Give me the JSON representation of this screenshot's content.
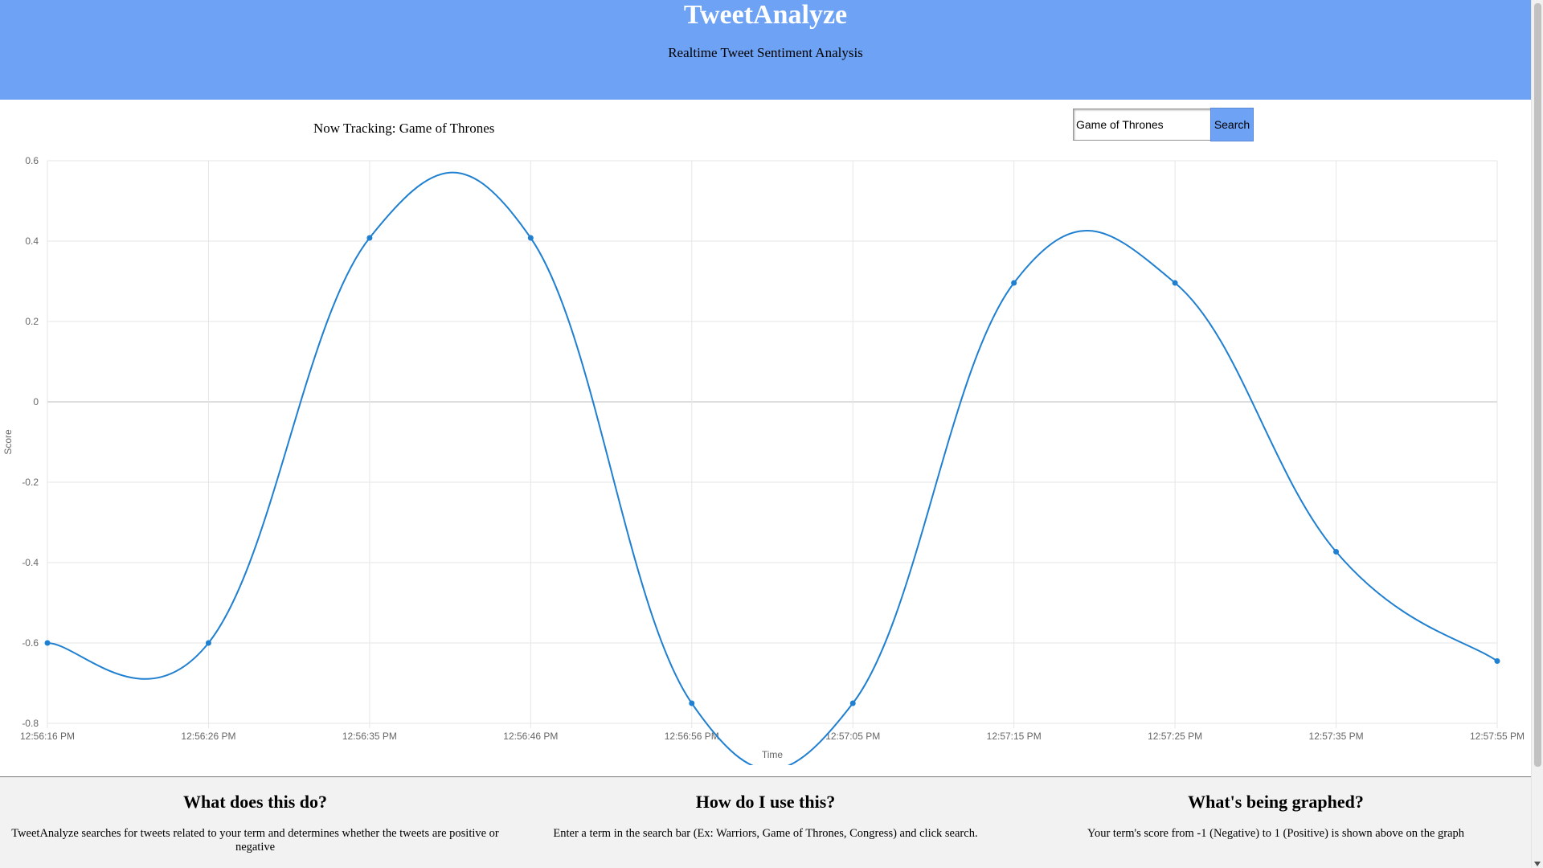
{
  "header": {
    "title": "TweetAnalyze",
    "subtitle": "Realtime Tweet Sentiment Analysis"
  },
  "tracking": {
    "label": "Now Tracking: Game of Thrones"
  },
  "search": {
    "value": "Game of Thrones",
    "button_label": "Search"
  },
  "chart_data": {
    "type": "line",
    "xlabel": "Time",
    "ylabel": "Score",
    "categories": [
      "12:56:16 PM",
      "12:56:26 PM",
      "12:56:35 PM",
      "12:56:46 PM",
      "12:56:56 PM",
      "12:57:05 PM",
      "12:57:15 PM",
      "12:57:25 PM",
      "12:57:35 PM",
      "12:57:55 PM"
    ],
    "values": [
      -0.6,
      -0.6,
      0.408,
      0.408,
      -0.75,
      -0.75,
      0.296,
      0.296,
      -0.373,
      -0.645
    ],
    "ylim": [
      -0.8,
      0.6
    ],
    "yticks": [
      "0.6",
      "0.4",
      "0.2",
      "0",
      "-0.2",
      "-0.4",
      "-0.6",
      "-0.8"
    ],
    "grid": true,
    "line_color": "#1f7fd0",
    "smooth": true
  },
  "info": [
    {
      "heading": "What does this do?",
      "text": "TweetAnalyze searches for tweets related to your term and determines whether the tweets are positive or negative"
    },
    {
      "heading": "How do I use this?",
      "text": "Enter a term in the search bar (Ex: Warriors, Game of Thrones, Congress) and click search."
    },
    {
      "heading": "What's being graphed?",
      "text": "Your term's score from -1 (Negative) to 1 (Positive) is shown above on the graph"
    }
  ],
  "colors": {
    "header_bg": "#6ea2f4",
    "title_color": "#ffffff",
    "footer_bg": "#f2f2f2",
    "grid": "#e6e6e6",
    "zero_line": "#bdbdbd"
  }
}
